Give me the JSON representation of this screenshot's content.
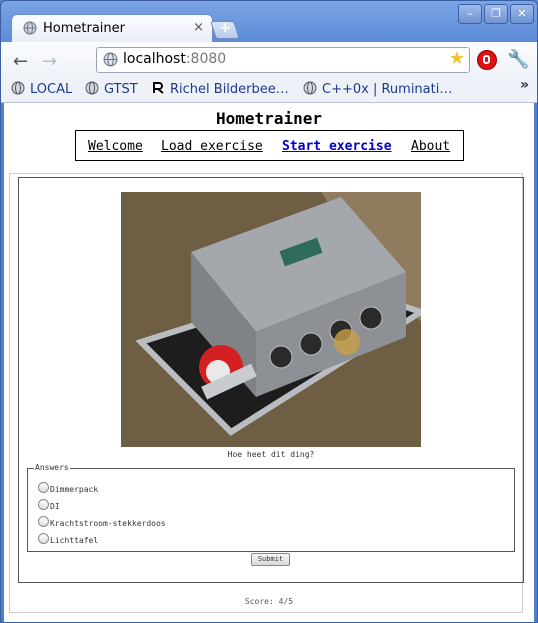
{
  "browser": {
    "tab_title": "Hometrainer",
    "tab_close": "×",
    "new_tab": "+",
    "window_buttons": [
      "–",
      "❐",
      "✕"
    ],
    "back": "←",
    "forward": "→",
    "url_host": "localhost",
    "url_port": ":8080",
    "star": "★",
    "wrench": "🔧",
    "bookmarks": [
      "LOCAL",
      "GTST",
      "Richel Bilderbee…",
      "C++0x | Ruminati…"
    ],
    "bookmarks_more": "»"
  },
  "page": {
    "title": "Hometrainer",
    "nav": [
      "Welcome",
      "Load exercise",
      "Start exercise",
      "About"
    ],
    "active_nav": "Start exercise",
    "question": "Hoe heet dit ding?",
    "answers_legend": "Answers",
    "answers": [
      "Dimmerpack",
      "DI",
      "Krachtstroom-stekkerdoos",
      "Lichttafel"
    ],
    "submit": "Submit",
    "score": "Score: 4/5"
  },
  "colors": {
    "chrome_blue": "#5b8ad6",
    "active_link": "#0000cc"
  }
}
